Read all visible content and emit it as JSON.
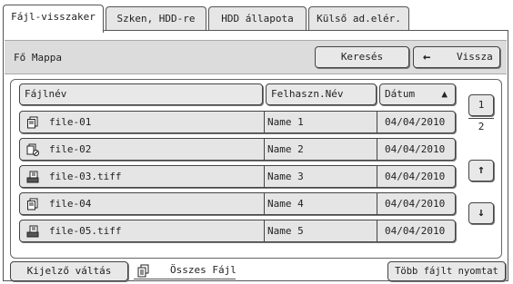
{
  "tabs": [
    {
      "label": "Fájl-visszaker"
    },
    {
      "label": "Szken, HDD-re"
    },
    {
      "label": "HDD állapota"
    },
    {
      "label": "Külső ad.elér."
    }
  ],
  "folder": {
    "name": "Fő Mappa"
  },
  "toolbar": {
    "search_label": "Keresés",
    "back_label": "Vissza",
    "back_icon": "←"
  },
  "columns": {
    "filename": "Fájlnév",
    "user": "Felhaszn.Név",
    "date": "Dátum",
    "sort_icon": "▲"
  },
  "files": [
    {
      "name": "file-01",
      "user": "Name 1",
      "date": "04/04/2010",
      "icon": "copy-icon"
    },
    {
      "name": "file-02",
      "user": "Name 2",
      "date": "04/04/2010",
      "icon": "copy-locked-icon"
    },
    {
      "name": "file-03.tiff",
      "user": "Name 3",
      "date": "04/04/2010",
      "icon": "scan-icon"
    },
    {
      "name": "file-04",
      "user": "Name 4",
      "date": "04/04/2010",
      "icon": "copy-icon"
    },
    {
      "name": "file-05.tiff",
      "user": "Name 5",
      "date": "04/04/2010",
      "icon": "scan-icon"
    }
  ],
  "pager": {
    "current": "1",
    "total": "2",
    "up_icon": "↑",
    "down_icon": "↓"
  },
  "footer": {
    "switch_label": "Kijelző váltás",
    "all_files_label": "Összes Fájl",
    "batch_print_label": "Több fájlt nyomtat"
  }
}
